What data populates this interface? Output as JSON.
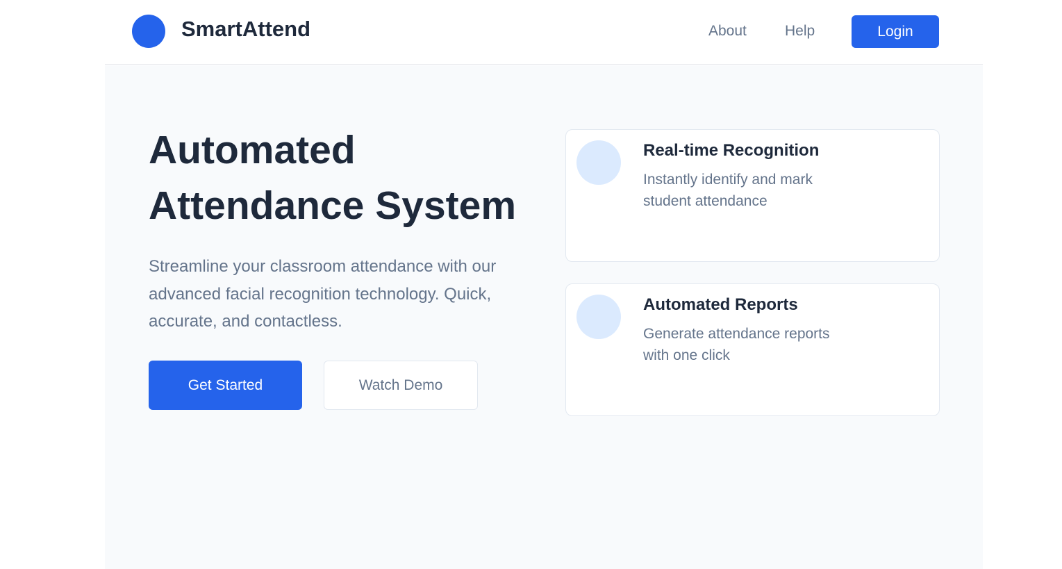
{
  "header": {
    "brand": "SmartAttend",
    "nav": {
      "about": "About",
      "help": "Help",
      "login": "Login"
    }
  },
  "hero": {
    "title": "Automated Attendance System",
    "subtitle": "Streamline your classroom attendance with our advanced facial recognition technology. Quick, accurate, and contactless.",
    "primary_button": "Get Started",
    "secondary_button": "Watch Demo"
  },
  "features": [
    {
      "title": "Real-time Recognition",
      "description": "Instantly identify and mark student attendance"
    },
    {
      "title": "Automated Reports",
      "description": "Generate attendance reports with one click"
    }
  ],
  "colors": {
    "primary": "#2563eb",
    "heading": "#1e293b",
    "muted": "#64748b",
    "background": "#f8fafc",
    "icon_bg": "#dbeafe"
  }
}
